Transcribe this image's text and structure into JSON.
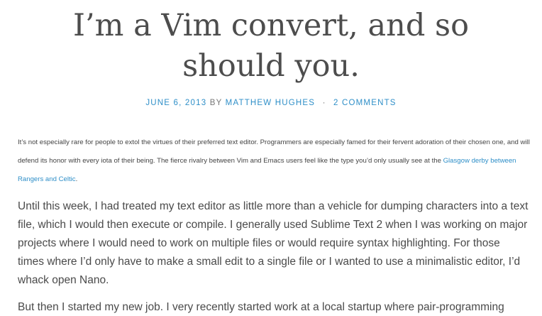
{
  "article": {
    "title": "I’m a Vim convert, and so should you.",
    "meta": {
      "date": "JUNE 6, 2013",
      "by": "BY",
      "author": "MATTHEW HUGHES",
      "separator": "·",
      "comments": "2 COMMENTS"
    },
    "intro": {
      "text_before_link": "It’s not especially rare for people to extol the virtues of their preferred text editor. Programmers are especially famed for their fervent adoration of their chosen one, and will defend its honor with every iota of their being. The fierce rivalry between Vim and Emacs users feel like the type you’d only usually see at the ",
      "link_text": "Glasgow derby between Rangers and Celtic",
      "text_after_link": "."
    },
    "paragraphs": [
      "Until this week, I had treated my text editor as little more than a vehicle for dumping characters into a text file, which I would then execute or compile. I generally used Sublime Text 2 when I was working on major projects where I would need to work on multiple files or would require syntax highlighting. For those times where I’d only have to make a small edit to a single file or I wanted to use a minimalistic editor, I’d whack open Nano.",
      "But then I started my new job. I very recently started work at a local startup where pair-programming"
    ]
  }
}
